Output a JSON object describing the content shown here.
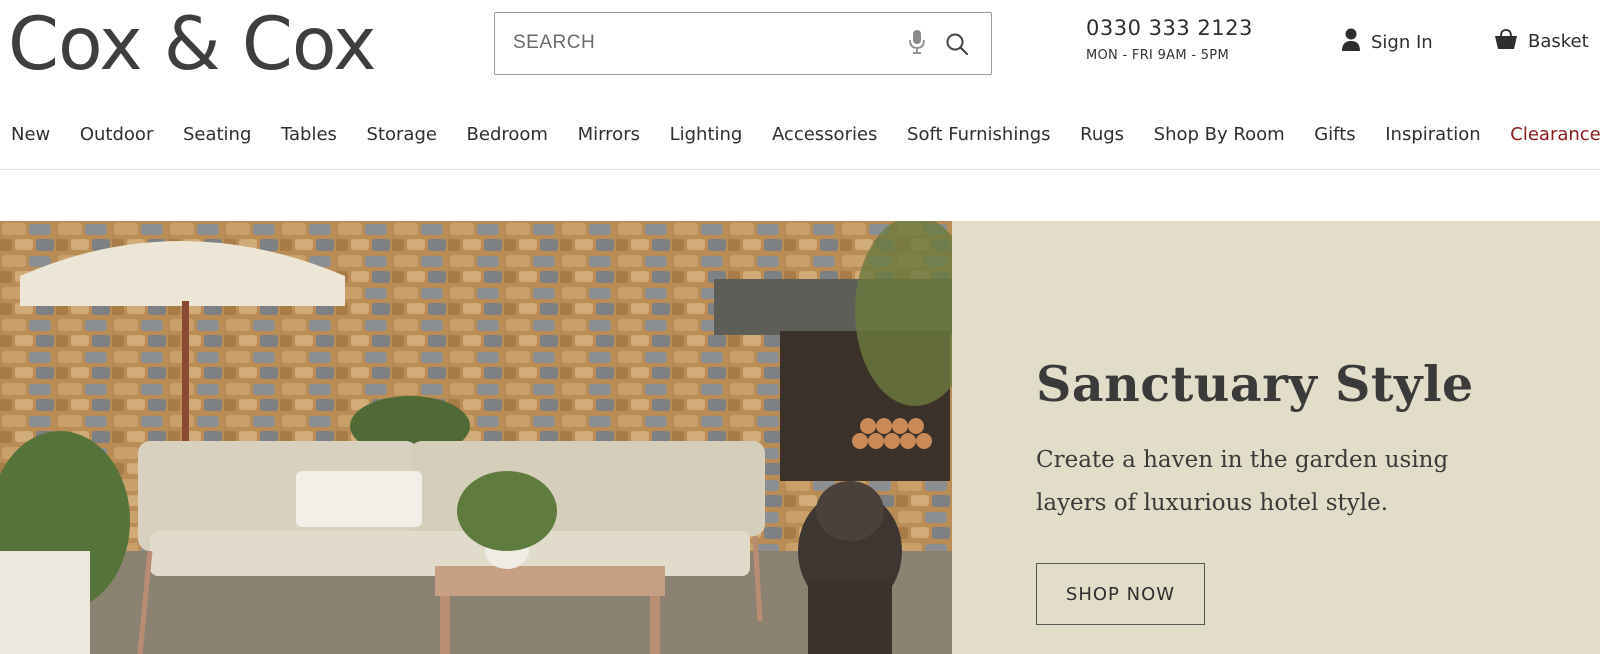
{
  "header": {
    "logo": "Cox & Cox",
    "search": {
      "placeholder": "SEARCH"
    },
    "phone": "0330 333 2123",
    "hours": "MON - FRI 9AM - 5PM",
    "sign_in": "Sign In",
    "basket": "Basket"
  },
  "nav": {
    "items": [
      {
        "label": "New"
      },
      {
        "label": "Outdoor"
      },
      {
        "label": "Seating"
      },
      {
        "label": "Tables"
      },
      {
        "label": "Storage"
      },
      {
        "label": "Bedroom"
      },
      {
        "label": "Mirrors"
      },
      {
        "label": "Lighting"
      },
      {
        "label": "Accessories"
      },
      {
        "label": "Soft Furnishings"
      },
      {
        "label": "Rugs"
      },
      {
        "label": "Shop By Room"
      },
      {
        "label": "Gifts"
      },
      {
        "label": "Inspiration"
      },
      {
        "label": "Clearance"
      }
    ]
  },
  "hero": {
    "title": "Sanctuary Style",
    "subtitle": "Create a haven in the garden using layers of luxurious hotel style.",
    "cta": "SHOP NOW"
  },
  "colors": {
    "panel_bg": "#e2ddc8",
    "clearance": "#8b1a1a",
    "text": "#2e2e2e"
  },
  "icons": {
    "mic": "microphone-icon",
    "search": "search-icon",
    "user": "user-icon",
    "basket": "basket-icon"
  }
}
